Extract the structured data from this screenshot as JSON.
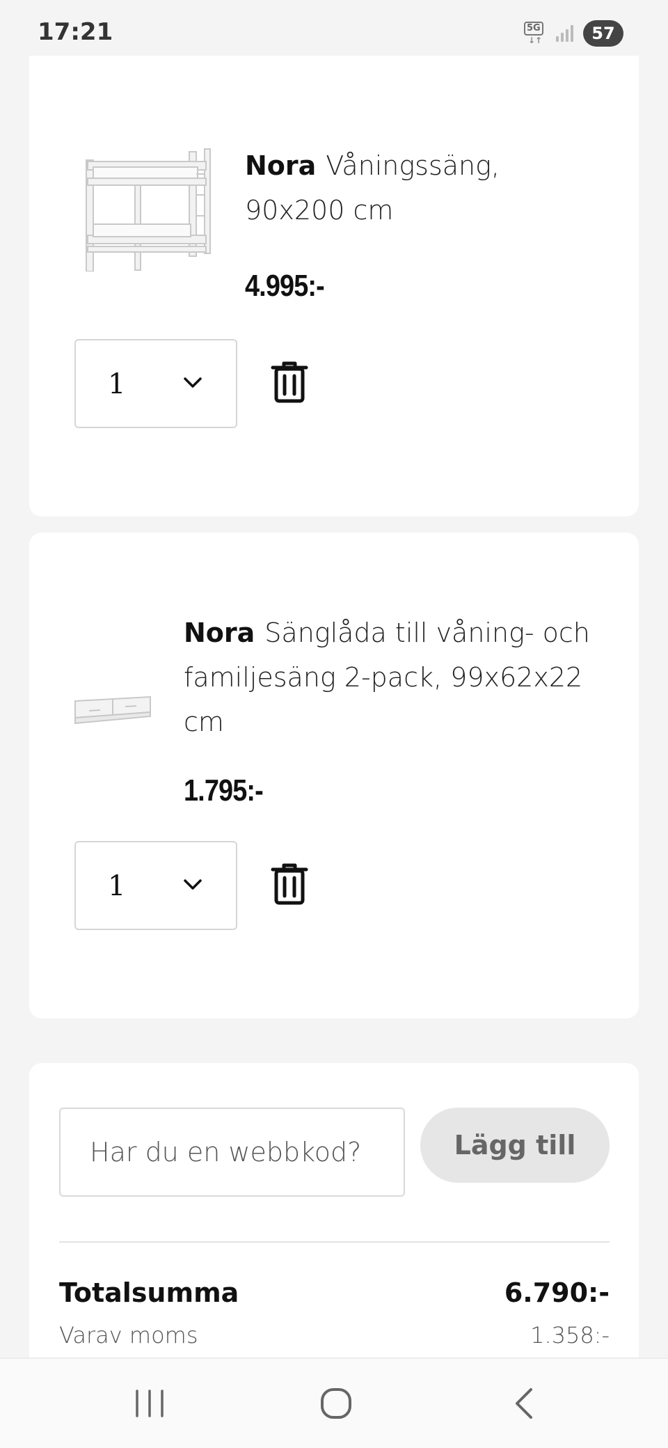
{
  "status_bar": {
    "time": "17:21",
    "network": "5G",
    "battery": "57"
  },
  "cart_items": [
    {
      "brand": "Nora",
      "name": "Våningssäng, 90x200 cm",
      "price": "4.995:-",
      "quantity": "1",
      "image_icon": "bunk-bed-image"
    },
    {
      "brand": "Nora",
      "name": "Sänglåda till våning- och familjesäng 2-pack, 99x62x22 cm",
      "price": "1.795:-",
      "quantity": "1",
      "image_icon": "bed-drawer-image"
    }
  ],
  "webcode": {
    "placeholder": "Har du en webbkod?",
    "button_label": "Lägg till"
  },
  "summary": {
    "total_label": "Totalsumma",
    "total_value": "6.790:-",
    "vat_label": "Varav moms",
    "vat_value": "1.358:-"
  },
  "colors": {
    "background": "#f4f4f4",
    "card": "#ffffff",
    "button_disabled": "#e6e6e6"
  }
}
